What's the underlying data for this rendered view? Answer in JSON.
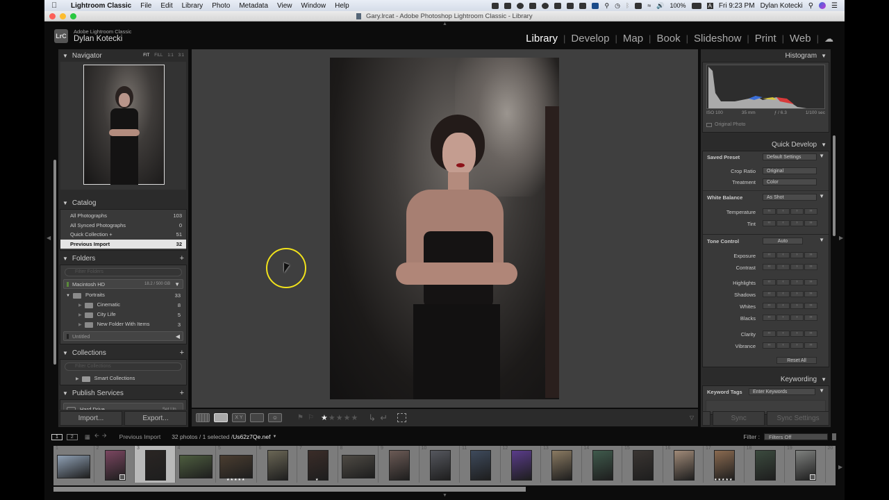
{
  "menubar": {
    "app": "Lightroom Classic",
    "items": [
      "File",
      "Edit",
      "Library",
      "Photo",
      "Metadata",
      "View",
      "Window",
      "Help"
    ],
    "battery": "100%",
    "input_source": "A",
    "clock": "Fri 9:23 PM",
    "user": "Dylan Kotecki"
  },
  "window": {
    "title": "Gary.lrcat - Adobe Photoshop Lightroom Classic - Library"
  },
  "identity": {
    "badge": "LrC",
    "product": "Adobe Lightroom Classic",
    "user": "Dylan Kotecki"
  },
  "modules": [
    "Library",
    "Develop",
    "Map",
    "Book",
    "Slideshow",
    "Print",
    "Web"
  ],
  "active_module": "Library",
  "navigator": {
    "title": "Navigator",
    "zoom_options": [
      "FIT",
      "FILL",
      "1:1",
      "3:1"
    ],
    "active_zoom": "FIT"
  },
  "catalog": {
    "title": "Catalog",
    "items": [
      {
        "label": "All Photographs",
        "count": "103"
      },
      {
        "label": "All Synced Photographs",
        "count": "0"
      },
      {
        "label": "Quick Collection +",
        "count": "51"
      },
      {
        "label": "Previous Import",
        "count": "32",
        "selected": true
      }
    ]
  },
  "folders": {
    "title": "Folders",
    "filter_placeholder": "Filter Folders",
    "volume": {
      "name": "Macintosh HD",
      "usage": "18.2 / 500 GB"
    },
    "items": [
      {
        "label": "Portraits",
        "count": "33",
        "level": 0,
        "expanded": true
      },
      {
        "label": "Cinematic",
        "count": "8",
        "level": 1
      },
      {
        "label": "City Life",
        "count": "5",
        "level": 1
      },
      {
        "label": "New Folder With Items",
        "count": "3",
        "level": 1
      }
    ],
    "volume2": {
      "name": "Untitled"
    }
  },
  "collections": {
    "title": "Collections",
    "filter_placeholder": "Filter Collections",
    "items": [
      {
        "label": "Smart Collections"
      }
    ]
  },
  "publish": {
    "title": "Publish Services",
    "items": [
      {
        "label": "Hard Drive",
        "action": "Set Up..."
      }
    ]
  },
  "left_buttons": {
    "import": "Import...",
    "export": "Export..."
  },
  "histogram": {
    "title": "Histogram",
    "iso": "ISO 100",
    "focal": "35 mm",
    "aperture": "ƒ / 6.3",
    "shutter": "1/100 sec",
    "original_photo": "Original Photo"
  },
  "quick_develop": {
    "title": "Quick Develop",
    "saved_preset_label": "Saved Preset",
    "saved_preset_value": "Default Settings",
    "crop_label": "Crop Ratio",
    "crop_value": "Original",
    "treatment_label": "Treatment",
    "treatment_value": "Color",
    "wb_label": "White Balance",
    "wb_value": "As Shot",
    "wb_rows": [
      "Temperature",
      "Tint"
    ],
    "tone_label": "Tone Control",
    "auto_label": "Auto",
    "tone_rows1": [
      "Exposure",
      "Contrast"
    ],
    "tone_rows2": [
      "Highlights",
      "Shadows",
      "Whites",
      "Blacks"
    ],
    "tone_rows3": [
      "Clarity",
      "Vibrance"
    ],
    "reset_label": "Reset All"
  },
  "keywording": {
    "title": "Keywording",
    "tags_label": "Keyword Tags",
    "tags_value": "Enter Keywords"
  },
  "sync": {
    "sync": "Sync",
    "sync_settings": "Sync Settings"
  },
  "toolbar": {
    "rating": 1,
    "rating_max": 5
  },
  "filmstrip": {
    "pages": [
      "1",
      "2"
    ],
    "source": "Previous Import",
    "info": "32 photos / 1 selected /",
    "filename": "Us62z7Qe.nef",
    "filter_label": "Filter :",
    "filter_value": "Filters Off",
    "items": [
      {
        "n": "1",
        "shape": "land",
        "c": "#8fa0b4"
      },
      {
        "n": "2",
        "shape": "port",
        "c": "#7a4660",
        "badge": true
      },
      {
        "n": "3",
        "shape": "port",
        "c": "#2a2523",
        "selected": true
      },
      {
        "n": "4",
        "shape": "land",
        "c": "#4d5d3f"
      },
      {
        "n": "5",
        "shape": "land",
        "c": "#4a3d30",
        "stars": 5
      },
      {
        "n": "6",
        "shape": "port",
        "c": "#6a6655"
      },
      {
        "n": "7",
        "shape": "port",
        "c": "#3a2c28",
        "stars": 1
      },
      {
        "n": "8",
        "shape": "land",
        "c": "#4e4a44"
      },
      {
        "n": "9",
        "shape": "port",
        "c": "#6b5a55"
      },
      {
        "n": "10",
        "shape": "port",
        "c": "#55575e"
      },
      {
        "n": "11",
        "shape": "port",
        "c": "#3e4a5c"
      },
      {
        "n": "12",
        "shape": "port",
        "c": "#5a3c8a"
      },
      {
        "n": "13",
        "shape": "port",
        "c": "#8a7a62"
      },
      {
        "n": "14",
        "shape": "port",
        "c": "#3f5a4c"
      },
      {
        "n": "15",
        "shape": "port",
        "c": "#3a3532"
      },
      {
        "n": "16",
        "shape": "port",
        "c": "#a08a78"
      },
      {
        "n": "17",
        "shape": "port",
        "c": "#8a6a50",
        "stars": 5
      },
      {
        "n": "18",
        "shape": "port",
        "c": "#3b4a3e"
      },
      {
        "n": "19",
        "shape": "port",
        "c": "#7e807e",
        "badge": true
      },
      {
        "n": "20",
        "shape": "port",
        "c": "#3a3530"
      }
    ]
  },
  "cursor": {
    "highlight_color": "#f2e31b"
  }
}
